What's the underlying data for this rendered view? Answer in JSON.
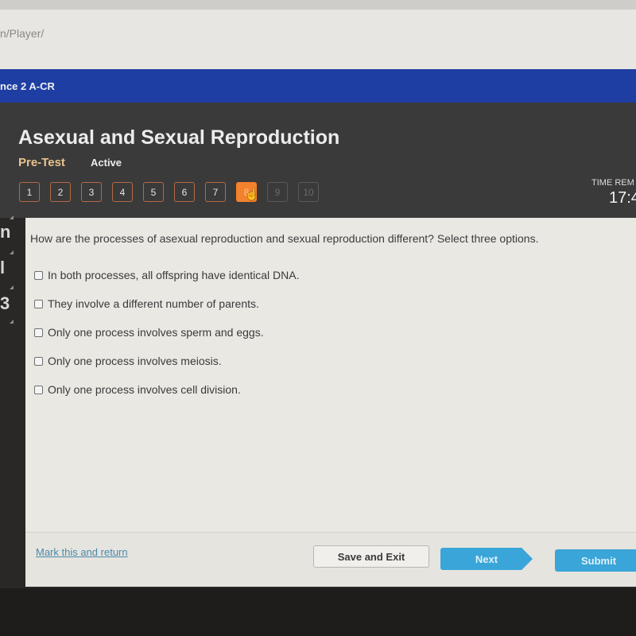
{
  "browser": {
    "url_fragment": "n/Player/"
  },
  "course": {
    "title_fragment": "nce 2 A-CR"
  },
  "header": {
    "title": "Asexual and Sexual Reproduction",
    "test_type": "Pre-Test",
    "status": "Active",
    "timer_label": "TIME REM",
    "timer_value": "17:4"
  },
  "question_nav": {
    "current": 8,
    "items": [
      {
        "label": "1",
        "state": "answered"
      },
      {
        "label": "2",
        "state": "answered"
      },
      {
        "label": "3",
        "state": "answered"
      },
      {
        "label": "4",
        "state": "answered"
      },
      {
        "label": "5",
        "state": "answered"
      },
      {
        "label": "6",
        "state": "answered"
      },
      {
        "label": "7",
        "state": "answered"
      },
      {
        "label": "8",
        "state": "current"
      },
      {
        "label": "9",
        "state": "locked"
      },
      {
        "label": "10",
        "state": "locked"
      }
    ]
  },
  "left_rail": {
    "fragments": [
      "n",
      "l",
      "3"
    ]
  },
  "question": {
    "text": "How are the processes of asexual reproduction and sexual reproduction different? Select three options.",
    "options": [
      {
        "label": "In both processes, all offspring have identical DNA.",
        "checked": false
      },
      {
        "label": "They involve a different number of parents.",
        "checked": false
      },
      {
        "label": "Only one process involves sperm and eggs.",
        "checked": false
      },
      {
        "label": "Only one process involves meiosis.",
        "checked": false
      },
      {
        "label": "Only one process involves cell division.",
        "checked": false
      }
    ]
  },
  "footer": {
    "mark_link": "Mark this and return",
    "save_exit": "Save and Exit",
    "next": "Next",
    "submit": "Submit"
  },
  "colors": {
    "brand_blue": "#1e3ea3",
    "accent_orange": "#f2822c",
    "button_blue": "#3aa5d8",
    "pretest_gold": "#e8c38e"
  }
}
